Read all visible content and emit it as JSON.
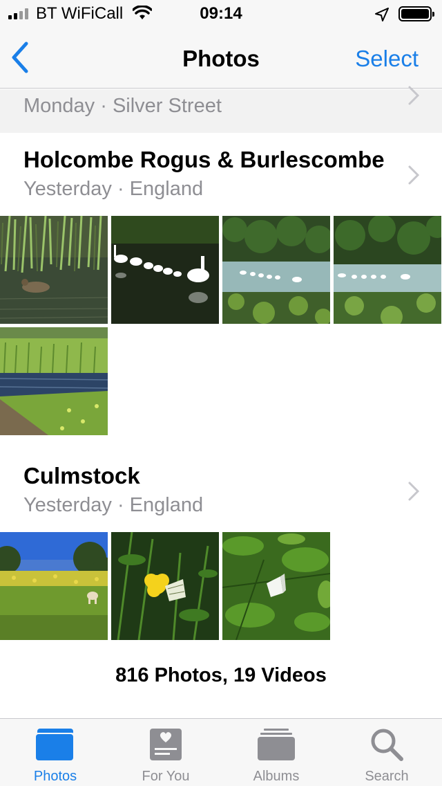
{
  "status": {
    "carrier": "BT WiFiCall",
    "time": "09:14"
  },
  "nav": {
    "title": "Photos",
    "select": "Select"
  },
  "previous_section": {
    "subtitle": "Monday · Silver Street"
  },
  "sections": [
    {
      "title": "Holcombe Rogus & Burlescombe",
      "subtitle": "Yesterday · England",
      "photos": [
        "duck-on-river",
        "swans-family-close",
        "swans-on-river",
        "swans-on-river-wide",
        "riverbank-meadow"
      ]
    },
    {
      "title": "Culmstock",
      "subtitle": "Yesterday · England",
      "photos": [
        "buttercup-field-dog",
        "butterfly-on-buttercup",
        "white-butterfly-leaves"
      ]
    }
  ],
  "summary": "816 Photos, 19 Videos",
  "tabs": [
    {
      "label": "Photos",
      "icon": "photos-icon",
      "active": true
    },
    {
      "label": "For You",
      "icon": "for-you-icon",
      "active": false
    },
    {
      "label": "Albums",
      "icon": "albums-icon",
      "active": false
    },
    {
      "label": "Search",
      "icon": "search-icon",
      "active": false
    }
  ],
  "colors": {
    "accent": "#1a7fe8",
    "secondary_text": "#8e8e93"
  }
}
